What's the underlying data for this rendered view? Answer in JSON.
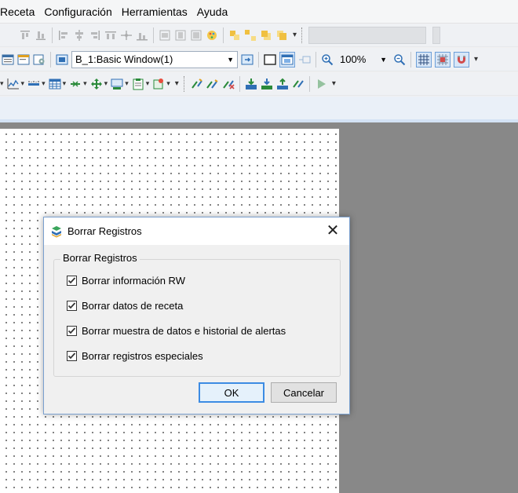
{
  "menu": [
    "Receta",
    "Configuración",
    "Herramientas",
    "Ayuda"
  ],
  "toolbar_window": {
    "window_select": "B_1:Basic Window(1)",
    "zoom": "100%"
  },
  "dialog": {
    "title": "Borrar Registros",
    "group_label": "Borrar Registros",
    "options": [
      {
        "label": "Borrar información RW",
        "checked": true
      },
      {
        "label": "Borrar datos de receta",
        "checked": true
      },
      {
        "label": "Borrar muestra de datos e historial de alertas",
        "checked": true
      },
      {
        "label": "Borrar registros especiales",
        "checked": true
      }
    ],
    "ok_label": "OK",
    "cancel_label": "Cancelar"
  },
  "colors": {
    "accent": "#3c8be3",
    "workspace": "#888888",
    "canvas": "#ffffff"
  }
}
